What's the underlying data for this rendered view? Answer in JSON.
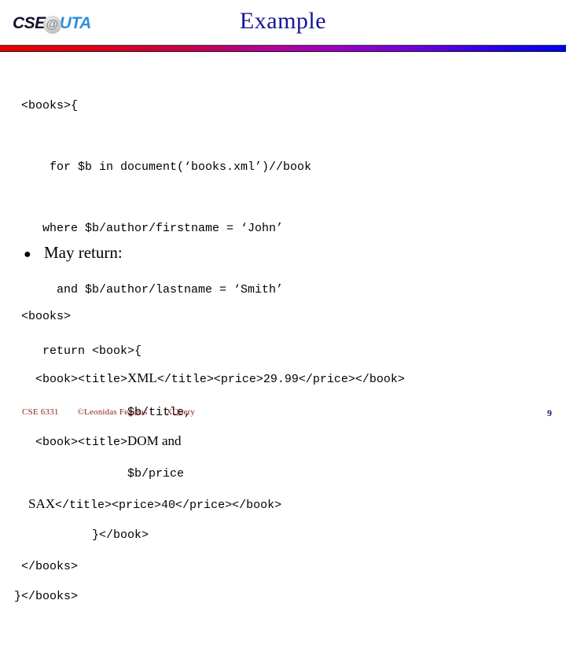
{
  "header": {
    "logo": {
      "cse": "CSE",
      "at": "@",
      "uta": "UTA"
    },
    "title": "Example",
    "rule_color_start": "#e60000",
    "rule_color_mid": "#b4009e",
    "rule_color_end": "#0000ee",
    "title_color": "#161695"
  },
  "body": {
    "query_code_lines": [
      "   <books>{",
      "       for $b in document(‘books.xml’)//book",
      "      where $b/author/firstname = ‘John’",
      "        and $b/author/lastname = ‘Smith’",
      "      return <book>{",
      "                  $b/title,",
      "                  $b/price",
      "             }</book>",
      "  }</books>"
    ],
    "bullet": {
      "glyph": "●",
      "label": "May return:"
    },
    "result_code_lines": [
      "   <books>",
      "     <book><title>XML</title><price>29.99</price></book>",
      "     <book><title>DOM and",
      "    SAX</title><price>40</price></book>",
      "   </books>"
    ],
    "result_emphasis": [
      "XML",
      "DOM and",
      "SAX"
    ]
  },
  "footer": {
    "course": "CSE 6331",
    "author": "©Leonidas Fegaras",
    "topic": "XQuery",
    "page_number": "9",
    "text_color": "#8b1a1a",
    "page_number_color": "#1b1b6e"
  }
}
